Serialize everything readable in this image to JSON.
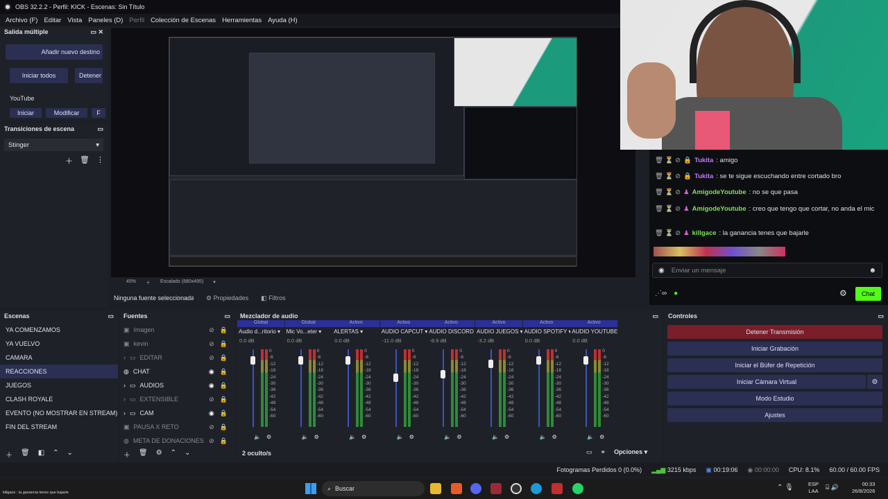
{
  "window": {
    "title": "OBS 32.2.2 - Perfil: KICK - Escenas: Sin Título"
  },
  "menu": [
    "Archivo (F)",
    "Editar",
    "Vista",
    "Paneles (D)",
    "Perfil",
    "Colección de Escenas",
    "Herramientas",
    "Ayuda (H)"
  ],
  "salida": {
    "title": "Salida múltiple",
    "add": "Añadir nuevo destino",
    "start_all": "Iniciar todos",
    "stop_all": "Detener",
    "youtube": "YouTube",
    "start": "Iniciar",
    "modify": "Modificar",
    "f": "F"
  },
  "transiciones": {
    "title": "Transiciones de escena",
    "selected": "Stinger"
  },
  "preview": {
    "zoom": "45%",
    "scale": "Escalado (880x495)"
  },
  "props": {
    "no_source": "Ninguna fuente seleccionada",
    "properties": "Propiedades",
    "filters": "Filtros"
  },
  "escenas": {
    "title": "Escenas",
    "items": [
      "YA COMENZAMOS",
      "YA VUELVO",
      "CAMARA",
      "REACCIONES",
      "JUEGOS",
      "CLASH ROYALE",
      "EVENTO (NO MOSTRAR EN STREAM)",
      "FIN DEL STREAM"
    ]
  },
  "fuentes": {
    "title": "Fuentes",
    "items": [
      "Imagen",
      "kevin",
      "EDITAR",
      "CHAT",
      "AUDIOS",
      "EXTENSIBLE",
      "CAM",
      "PAUSA X RETO",
      "META DE DONACIONES"
    ]
  },
  "mixer": {
    "title": "Mezclador de audio",
    "hidden": "2 oculto/s",
    "options": "Opciones",
    "channels": [
      {
        "tag": "Global",
        "name": "Audio d...ritorio",
        "db": "0.0 dB"
      },
      {
        "tag": "Global",
        "name": "Mic Vo...eter",
        "db": "0.0 dB"
      },
      {
        "tag": "Activo",
        "name": "ALERTAS",
        "db": "0.0 dB"
      },
      {
        "tag": "Activo",
        "name": "AUDIO CAPCUT",
        "db": "-11.0 dB"
      },
      {
        "tag": "Activo",
        "name": "AUDIO DISCORD",
        "db": "-8.9 dB"
      },
      {
        "tag": "Activo",
        "name": "AUDIO JUEGOS",
        "db": "-3.2 dB"
      },
      {
        "tag": "Activo",
        "name": "AUDIO SPOTIFY",
        "db": "0.0 dB"
      },
      {
        "tag": "Activo",
        "name": "AUDIO YOUTUBE",
        "db": "0.0 dB"
      }
    ],
    "scale": [
      "0",
      "-6",
      "-12",
      "-18",
      "-24",
      "-30",
      "-36",
      "-42",
      "-48",
      "-54",
      "-60"
    ]
  },
  "controles": {
    "title": "Controles",
    "stop": "Detener Transmisión",
    "record": "Iniciar Grabación",
    "replay": "Iniciar el Búfer de Repetición",
    "virtualcam": "Iniciar Cámara Virtual",
    "studio": "Modo Estudio",
    "settings": "Ajustes"
  },
  "chat": {
    "lines": [
      {
        "user": "Tukita",
        "msg": ": amigo",
        "color": "#c07bf2"
      },
      {
        "user": "Tukita",
        "msg": ": se te sigue escuchando entre cortado bro",
        "color": "#c07bf2"
      },
      {
        "user": "AmigodeYoutube",
        "msg": ": no se que pasa",
        "color": "#7ee05a"
      },
      {
        "user": "AmigodeYoutube",
        "msg": ": creo que tengo que cortar, no anda el mic",
        "color": "#7ee05a"
      },
      {
        "user": "killgace",
        "msg": ": la ganancia tenes que bajarle",
        "color": "#7ee05a"
      }
    ],
    "placeholder": "Enviar un mensaje",
    "button": "Chat"
  },
  "status": {
    "dropped": "Fotogramas Perdidos 0 (0.0%)",
    "kbps": "3215 kbps",
    "live": "00:19:06",
    "rec": "00:00:00",
    "cpu": "CPU: 8.1%",
    "fps": "60.00 / 60.00 FPS"
  },
  "taskbar": {
    "search": "Buscar",
    "lang1": "ESP",
    "lang2": "LAA",
    "time": "00:33",
    "date": "26/8/2026",
    "toast": "killgace : la ganancia tenes que bajarle"
  },
  "colors": {
    "accent": "#2b2f52",
    "kick": "#53fc18",
    "live_red": "#7a1e2a"
  }
}
